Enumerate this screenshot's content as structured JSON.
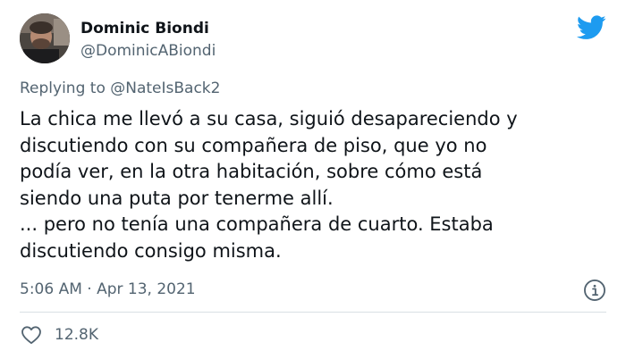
{
  "author": {
    "display_name": "Dominic Biondi",
    "handle": "@DominicABiondi"
  },
  "platform_icon": "twitter-bird-icon",
  "reply": {
    "prefix": "Replying to",
    "mention": "@NateIsBack2"
  },
  "tweet_lines": [
    "La chica me llevó a su casa, siguió desapareciendo y",
    "discutiendo con su compañera de piso, que yo no",
    "podía ver, en la otra habitación, sobre cómo está",
    "siendo una puta por tenerme allí.",
    "... pero no tenía una compañera de cuarto. Estaba",
    "discutiendo consigo misma."
  ],
  "timestamp": "5:06 AM · Apr 13, 2021",
  "info_icon": "info-icon",
  "engagement": {
    "like_icon": "heart-icon",
    "likes": "12.8K"
  },
  "colors": {
    "brand": "#1d9bf0",
    "secondary_text": "#536471",
    "primary_text": "#0f1419"
  }
}
